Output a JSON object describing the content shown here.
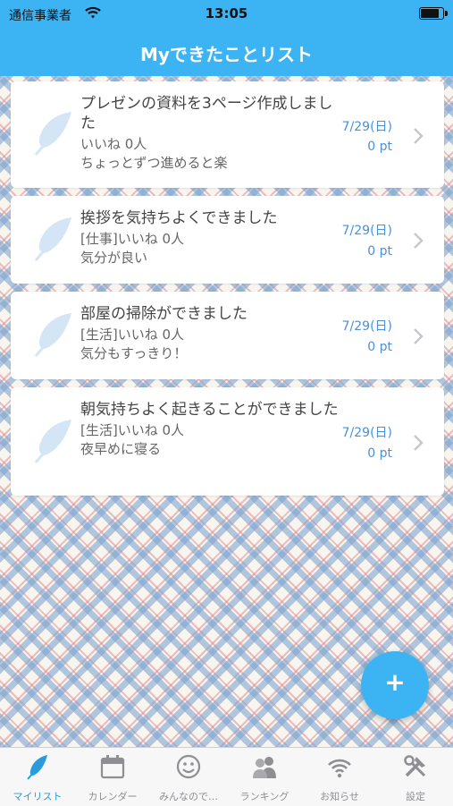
{
  "status_bar": {
    "carrier": "通信事業者",
    "time": "13:05",
    "battery_level": 0.85
  },
  "nav": {
    "title": "Myできたことリスト"
  },
  "items": [
    {
      "title": "プレゼンの資料を3ページ作成しました",
      "meta": "いいね 0人",
      "comment": "ちょっとずつ進めると楽",
      "date": "7/29(日)",
      "points": "0 pt"
    },
    {
      "title": "挨拶を気持ちよくできました",
      "meta": "[仕事]いいね 0人",
      "comment": "気分が良い",
      "date": "7/29(日)",
      "points": "0 pt"
    },
    {
      "title": "部屋の掃除ができました",
      "meta": "[生活]いいね 0人",
      "comment": "気分もすっきり！",
      "date": "7/29(日)",
      "points": "0 pt"
    },
    {
      "title": "朝気持ちよく起きることができました",
      "meta": "[生活]いいね 0人",
      "comment": "夜早めに寝る",
      "date": "7/29(日)",
      "points": "0 pt"
    }
  ],
  "fab": {
    "label": "+"
  },
  "tabs": [
    {
      "label": "マイリスト",
      "icon": "feather-icon",
      "active": true
    },
    {
      "label": "カレンダー",
      "icon": "calendar-icon",
      "active": false
    },
    {
      "label": "みんなので…",
      "icon": "smiley-icon",
      "active": false
    },
    {
      "label": "ランキング",
      "icon": "people-icon",
      "active": false
    },
    {
      "label": "お知らせ",
      "icon": "wifi-icon",
      "active": false
    },
    {
      "label": "設定",
      "icon": "tools-icon",
      "active": false
    }
  ],
  "colors": {
    "accent": "#3cb3f3",
    "date_text": "#4a90d9",
    "active_tab": "#2a9bdb"
  }
}
